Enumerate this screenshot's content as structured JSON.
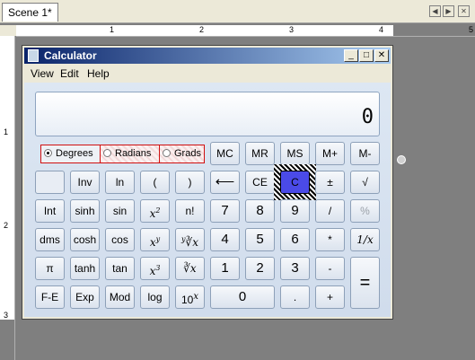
{
  "tabs": [
    {
      "label": "Scene 1*"
    }
  ],
  "ruler": {
    "h_ticks": [
      "1",
      "2",
      "3",
      "4",
      "5"
    ],
    "v_ticks": [
      "1",
      "2",
      "3"
    ]
  },
  "window": {
    "title": "Calculator",
    "minimize": "_",
    "maximize": "□",
    "close": "✕"
  },
  "menu": [
    "View",
    "Edit",
    "Help"
  ],
  "display": {
    "value": "0"
  },
  "angle_modes": [
    {
      "label": "Degrees",
      "selected": true
    },
    {
      "label": "Radians",
      "selected": false
    },
    {
      "label": "Grads",
      "selected": false
    }
  ],
  "keys": {
    "mc": "MC",
    "mr": "MR",
    "ms": "MS",
    "mplus": "M+",
    "mminus": "M-",
    "inv": "Inv",
    "ln": "ln",
    "lparen": "(",
    "rparen": ")",
    "back": "⟵",
    "ce": "CE",
    "c": "C",
    "plusminus": "±",
    "sqrt": "√",
    "int": "Int",
    "sinh": "sinh",
    "sin": "sin",
    "x2": "x",
    "x2_sup": "2",
    "fact": "n!",
    "k7": "7",
    "k8": "8",
    "k9": "9",
    "div": "/",
    "pct": "%",
    "dms": "dms",
    "cosh": "cosh",
    "cos": "cos",
    "xy": "x",
    "xy_sup": "y",
    "yroot": "∛x",
    "yroot_pre": "y",
    "k4": "4",
    "k5": "5",
    "k6": "6",
    "mul": "*",
    "recip": "1/x",
    "pi": "π",
    "tanh": "tanh",
    "tan": "tan",
    "x3": "x",
    "x3_sup": "3",
    "cuberoot": "∛x",
    "k1": "1",
    "k2": "2",
    "k3": "3",
    "sub": "-",
    "eq": "=",
    "fe": "F-E",
    "exp": "Exp",
    "mod": "Mod",
    "log": "log",
    "tenx": "10",
    "tenx_sup": "x",
    "k0": "0",
    "dot": ".",
    "add": "+"
  }
}
